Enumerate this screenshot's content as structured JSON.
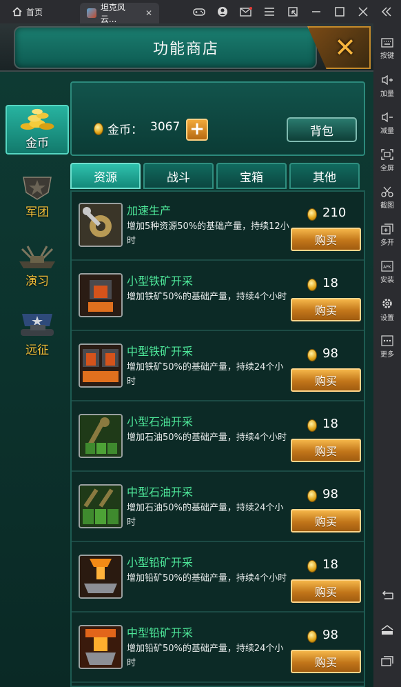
{
  "emulator": {
    "home_tab": "首页",
    "app_tab": "坦克风云...",
    "tab_close": "✕",
    "side_items": [
      {
        "icon": "keyboard-icon",
        "label": "按键"
      },
      {
        "icon": "volume-up-icon",
        "label": "加量"
      },
      {
        "icon": "volume-down-icon",
        "label": "减量"
      },
      {
        "icon": "fullscreen-icon",
        "label": "全屏"
      },
      {
        "icon": "scissors-icon",
        "label": "截图"
      },
      {
        "icon": "multi-open-icon",
        "label": "多开"
      },
      {
        "icon": "apk-icon",
        "label": "安装"
      },
      {
        "icon": "gear-icon",
        "label": "设置"
      },
      {
        "icon": "more-icon",
        "label": "更多"
      }
    ]
  },
  "shop": {
    "title": "功能商店",
    "categories": [
      "金币",
      "军团",
      "演习",
      "远征"
    ],
    "wallet": {
      "label": "金币：",
      "amount": "3067",
      "plus": "+",
      "bag_label": "背包"
    },
    "tabs": [
      "资源",
      "战斗",
      "宝箱",
      "其他"
    ],
    "buy_label": "购买",
    "items": [
      {
        "name": "加速生产",
        "desc": "增加5种资源50%的基础产量，持续12小时",
        "price": "210",
        "icon": "gear-wrench-icon"
      },
      {
        "name": "小型铁矿开采",
        "desc": "增加铁矿50%的基础产量，持续4个小时",
        "price": "18",
        "icon": "furnace-icon"
      },
      {
        "name": "中型铁矿开采",
        "desc": "增加铁矿50%的基础产量，持续24个小时",
        "price": "98",
        "icon": "double-furnace-icon"
      },
      {
        "name": "小型石油开采",
        "desc": "增加石油50%的基础产量，持续4个小时",
        "price": "18",
        "icon": "oil-pump-icon"
      },
      {
        "name": "中型石油开采",
        "desc": "增加石油50%的基础产量，持续24个小时",
        "price": "98",
        "icon": "oil-barrels-icon"
      },
      {
        "name": "小型铅矿开采",
        "desc": "增加铅矿50%的基础产量，持续4个小时",
        "price": "18",
        "icon": "molten-ingot-icon"
      },
      {
        "name": "中型铅矿开采",
        "desc": "增加铅矿50%的基础产量，持续24个小时",
        "price": "98",
        "icon": "ingot-press-icon"
      }
    ]
  }
}
